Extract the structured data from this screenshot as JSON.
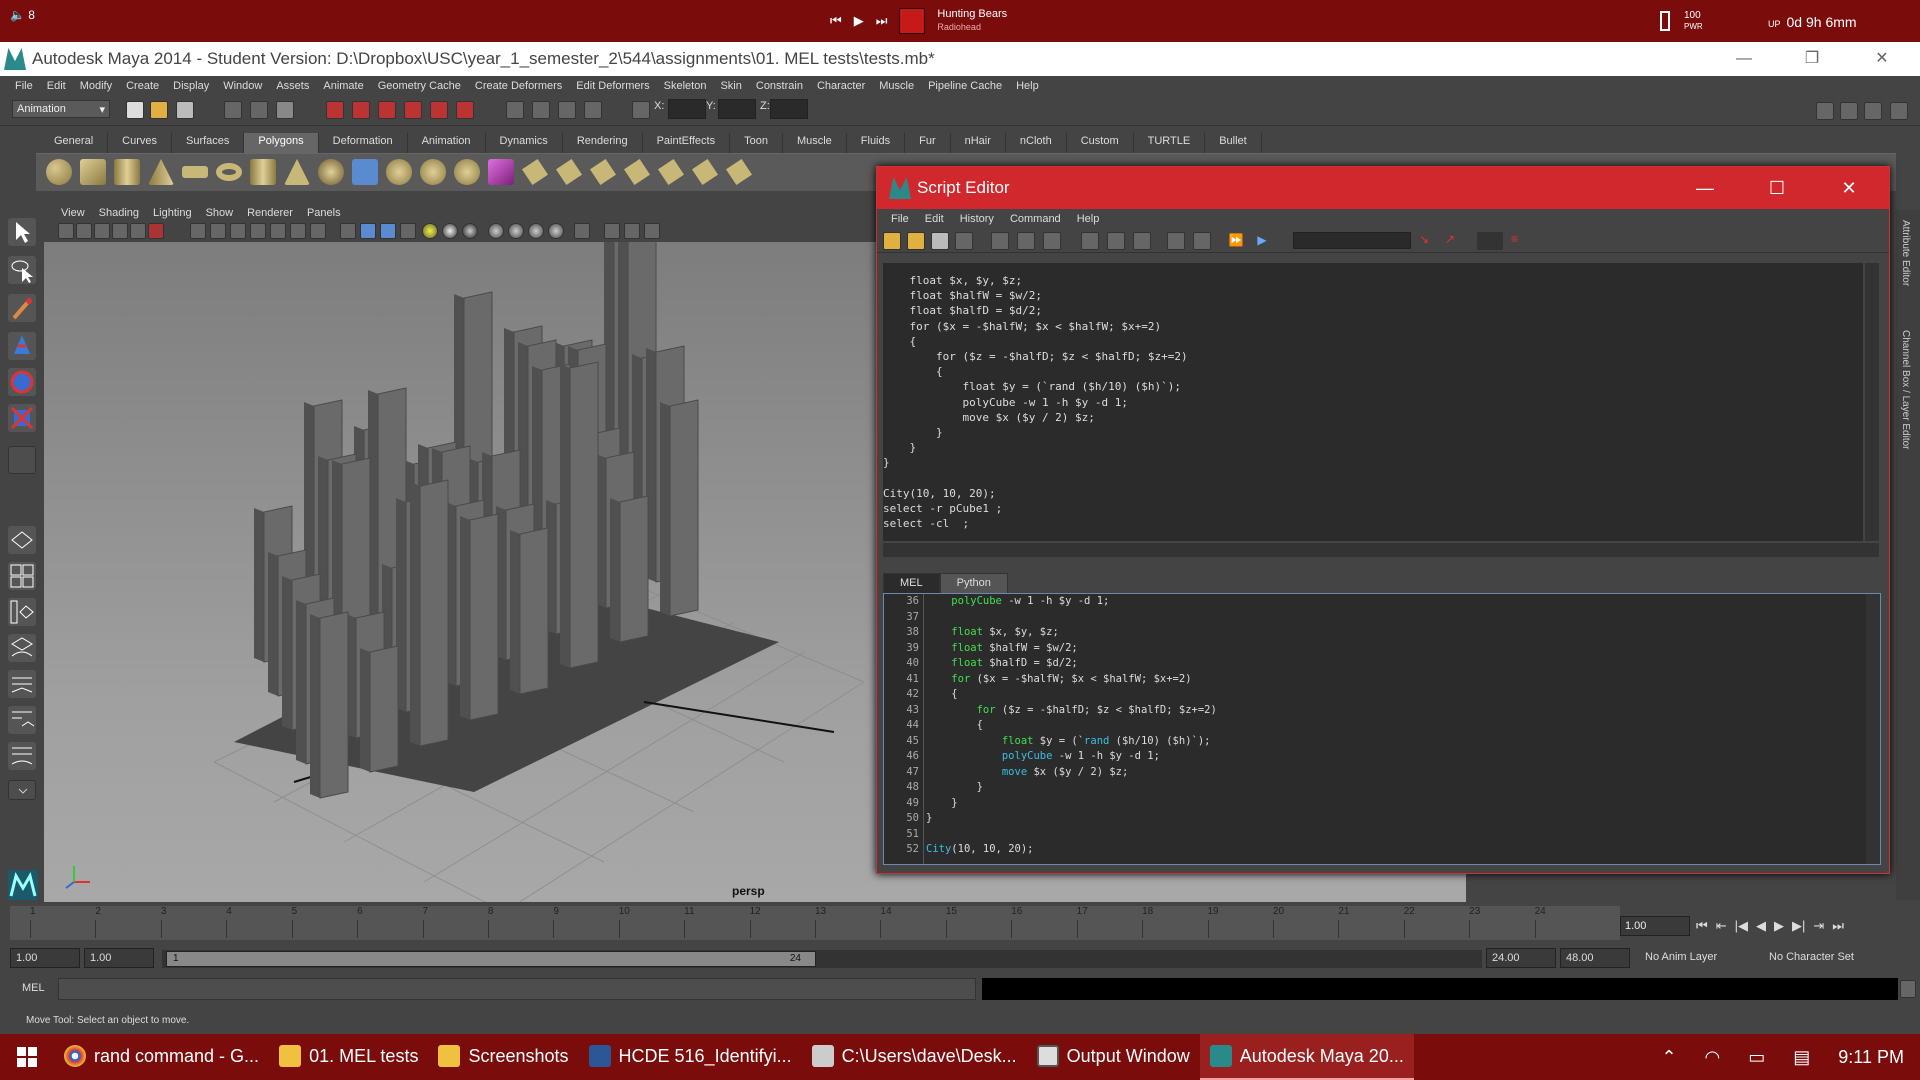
{
  "topbar": {
    "volume": "8",
    "track_title": "Hunting Bears",
    "track_artist": "Radiohead",
    "battery_pct": "100",
    "battery_label": "PWR",
    "uptime_label": "UP",
    "uptime": "0d 9h 6mm"
  },
  "window": {
    "title": "Autodesk Maya 2014 - Student Version: D:\\Dropbox\\USC\\year_1_semester_2\\544\\assignments\\01. MEL tests\\tests.mb*"
  },
  "menu": [
    "File",
    "Edit",
    "Modify",
    "Create",
    "Display",
    "Window",
    "Assets",
    "Animate",
    "Geometry Cache",
    "Create Deformers",
    "Edit Deformers",
    "Skeleton",
    "Skin",
    "Constrain",
    "Character",
    "Muscle",
    "Pipeline Cache",
    "Help"
  ],
  "statusline": {
    "mode": "Animation",
    "x_label": "X:",
    "y_label": "Y:",
    "z_label": "Z:"
  },
  "shelf_tabs": [
    "General",
    "Curves",
    "Surfaces",
    "Polygons",
    "Deformation",
    "Animation",
    "Dynamics",
    "Rendering",
    "PaintEffects",
    "Toon",
    "Muscle",
    "Fluids",
    "Fur",
    "nHair",
    "nCloth",
    "Custom",
    "TURTLE",
    "Bullet"
  ],
  "shelf_active": "Polygons",
  "viewport": {
    "menu": [
      "View",
      "Shading",
      "Lighting",
      "Show",
      "Renderer",
      "Panels"
    ],
    "camera": "persp"
  },
  "rightstrip": {
    "attribute_editor": "Attribute Editor",
    "channel_box": "Channel Box / Layer Editor"
  },
  "timeline": {
    "ticks": [
      "1",
      "2",
      "3",
      "4",
      "5",
      "6",
      "7",
      "8",
      "9",
      "10",
      "11",
      "12",
      "13",
      "14",
      "15",
      "16",
      "17",
      "18",
      "19",
      "20",
      "21",
      "22",
      "23",
      "24"
    ],
    "current_frame": "1.00"
  },
  "range": {
    "start": "1.00",
    "inner_start": "1.00",
    "slider_start": "1",
    "slider_end": "24",
    "end": "24.00",
    "outer_end": "48.00",
    "anim_layer": "No Anim Layer",
    "character_set": "No Character Set"
  },
  "cmdline": {
    "label": "MEL"
  },
  "helpline": "Move Tool: Select an object to move.",
  "taskbar": {
    "tasks": [
      "rand command - G...",
      "01. MEL tests",
      "Screenshots",
      "HCDE 516_Identifyi...",
      "C:\\Users\\dave\\Desk...",
      "Output Window",
      "Autodesk Maya 20..."
    ],
    "clock": "9:11 PM"
  },
  "script_editor": {
    "title": "Script Editor",
    "menu": [
      "File",
      "Edit",
      "History",
      "Command",
      "Help"
    ],
    "history": "    float $x, $y, $z;\n    float $halfW = $w/2;\n    float $halfD = $d/2;\n    for ($x = -$halfW; $x < $halfW; $x+=2)\n    {\n        for ($z = -$halfD; $z < $halfD; $z+=2)\n        {\n            float $y = (`rand ($h/10) ($h)`);\n            polyCube -w 1 -h $y -d 1;\n            move $x ($y / 2) $z;\n        }\n    }\n}\n\nCity(10, 10, 20);\nselect -r pCube1 ;\nselect -cl  ;",
    "tabs": [
      "MEL",
      "Python"
    ],
    "active_tab": "MEL",
    "line_numbers": "36\n37\n38\n39\n40\n41\n42\n43\n44\n45\n46\n47\n48\n49\n50\n51\n52"
  }
}
